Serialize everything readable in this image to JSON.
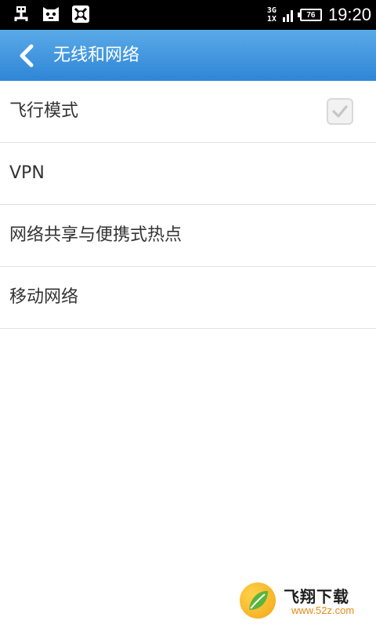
{
  "status_bar": {
    "left_icons": [
      "usb-icon",
      "cat-face-icon",
      "x-box-icon"
    ],
    "network_top": "3G",
    "network_bottom": "1X",
    "battery": "76",
    "time": "19:20"
  },
  "header": {
    "back_icon": "back-arrow-icon",
    "title": "无线和网络"
  },
  "settings": {
    "items": [
      {
        "label": "飞行模式",
        "checkbox": true
      },
      {
        "label": "VPN"
      },
      {
        "label": "网络共享与便携式热点"
      },
      {
        "label": "移动网络"
      }
    ]
  },
  "watermark": {
    "brand": "飞翔下载",
    "url": "www.52z.com"
  },
  "colors": {
    "header_top": "#5aaae8",
    "header_bottom": "#2f86d6",
    "divider": "#e2e2e2"
  }
}
